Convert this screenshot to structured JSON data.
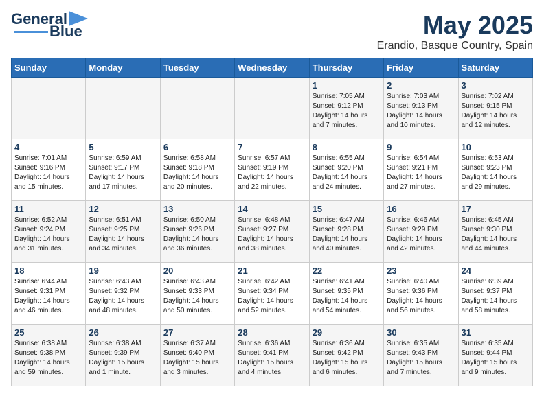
{
  "logo": {
    "line1": "General",
    "line2": "Blue"
  },
  "header": {
    "month": "May 2025",
    "location": "Erandio, Basque Country, Spain"
  },
  "days_of_week": [
    "Sunday",
    "Monday",
    "Tuesday",
    "Wednesday",
    "Thursday",
    "Friday",
    "Saturday"
  ],
  "weeks": [
    [
      {
        "day": "",
        "text": ""
      },
      {
        "day": "",
        "text": ""
      },
      {
        "day": "",
        "text": ""
      },
      {
        "day": "",
        "text": ""
      },
      {
        "day": "1",
        "text": "Sunrise: 7:05 AM\nSunset: 9:12 PM\nDaylight: 14 hours\nand 7 minutes."
      },
      {
        "day": "2",
        "text": "Sunrise: 7:03 AM\nSunset: 9:13 PM\nDaylight: 14 hours\nand 10 minutes."
      },
      {
        "day": "3",
        "text": "Sunrise: 7:02 AM\nSunset: 9:15 PM\nDaylight: 14 hours\nand 12 minutes."
      }
    ],
    [
      {
        "day": "4",
        "text": "Sunrise: 7:01 AM\nSunset: 9:16 PM\nDaylight: 14 hours\nand 15 minutes."
      },
      {
        "day": "5",
        "text": "Sunrise: 6:59 AM\nSunset: 9:17 PM\nDaylight: 14 hours\nand 17 minutes."
      },
      {
        "day": "6",
        "text": "Sunrise: 6:58 AM\nSunset: 9:18 PM\nDaylight: 14 hours\nand 20 minutes."
      },
      {
        "day": "7",
        "text": "Sunrise: 6:57 AM\nSunset: 9:19 PM\nDaylight: 14 hours\nand 22 minutes."
      },
      {
        "day": "8",
        "text": "Sunrise: 6:55 AM\nSunset: 9:20 PM\nDaylight: 14 hours\nand 24 minutes."
      },
      {
        "day": "9",
        "text": "Sunrise: 6:54 AM\nSunset: 9:21 PM\nDaylight: 14 hours\nand 27 minutes."
      },
      {
        "day": "10",
        "text": "Sunrise: 6:53 AM\nSunset: 9:23 PM\nDaylight: 14 hours\nand 29 minutes."
      }
    ],
    [
      {
        "day": "11",
        "text": "Sunrise: 6:52 AM\nSunset: 9:24 PM\nDaylight: 14 hours\nand 31 minutes."
      },
      {
        "day": "12",
        "text": "Sunrise: 6:51 AM\nSunset: 9:25 PM\nDaylight: 14 hours\nand 34 minutes."
      },
      {
        "day": "13",
        "text": "Sunrise: 6:50 AM\nSunset: 9:26 PM\nDaylight: 14 hours\nand 36 minutes."
      },
      {
        "day": "14",
        "text": "Sunrise: 6:48 AM\nSunset: 9:27 PM\nDaylight: 14 hours\nand 38 minutes."
      },
      {
        "day": "15",
        "text": "Sunrise: 6:47 AM\nSunset: 9:28 PM\nDaylight: 14 hours\nand 40 minutes."
      },
      {
        "day": "16",
        "text": "Sunrise: 6:46 AM\nSunset: 9:29 PM\nDaylight: 14 hours\nand 42 minutes."
      },
      {
        "day": "17",
        "text": "Sunrise: 6:45 AM\nSunset: 9:30 PM\nDaylight: 14 hours\nand 44 minutes."
      }
    ],
    [
      {
        "day": "18",
        "text": "Sunrise: 6:44 AM\nSunset: 9:31 PM\nDaylight: 14 hours\nand 46 minutes."
      },
      {
        "day": "19",
        "text": "Sunrise: 6:43 AM\nSunset: 9:32 PM\nDaylight: 14 hours\nand 48 minutes."
      },
      {
        "day": "20",
        "text": "Sunrise: 6:43 AM\nSunset: 9:33 PM\nDaylight: 14 hours\nand 50 minutes."
      },
      {
        "day": "21",
        "text": "Sunrise: 6:42 AM\nSunset: 9:34 PM\nDaylight: 14 hours\nand 52 minutes."
      },
      {
        "day": "22",
        "text": "Sunrise: 6:41 AM\nSunset: 9:35 PM\nDaylight: 14 hours\nand 54 minutes."
      },
      {
        "day": "23",
        "text": "Sunrise: 6:40 AM\nSunset: 9:36 PM\nDaylight: 14 hours\nand 56 minutes."
      },
      {
        "day": "24",
        "text": "Sunrise: 6:39 AM\nSunset: 9:37 PM\nDaylight: 14 hours\nand 58 minutes."
      }
    ],
    [
      {
        "day": "25",
        "text": "Sunrise: 6:38 AM\nSunset: 9:38 PM\nDaylight: 14 hours\nand 59 minutes."
      },
      {
        "day": "26",
        "text": "Sunrise: 6:38 AM\nSunset: 9:39 PM\nDaylight: 15 hours\nand 1 minute."
      },
      {
        "day": "27",
        "text": "Sunrise: 6:37 AM\nSunset: 9:40 PM\nDaylight: 15 hours\nand 3 minutes."
      },
      {
        "day": "28",
        "text": "Sunrise: 6:36 AM\nSunset: 9:41 PM\nDaylight: 15 hours\nand 4 minutes."
      },
      {
        "day": "29",
        "text": "Sunrise: 6:36 AM\nSunset: 9:42 PM\nDaylight: 15 hours\nand 6 minutes."
      },
      {
        "day": "30",
        "text": "Sunrise: 6:35 AM\nSunset: 9:43 PM\nDaylight: 15 hours\nand 7 minutes."
      },
      {
        "day": "31",
        "text": "Sunrise: 6:35 AM\nSunset: 9:44 PM\nDaylight: 15 hours\nand 9 minutes."
      }
    ]
  ]
}
